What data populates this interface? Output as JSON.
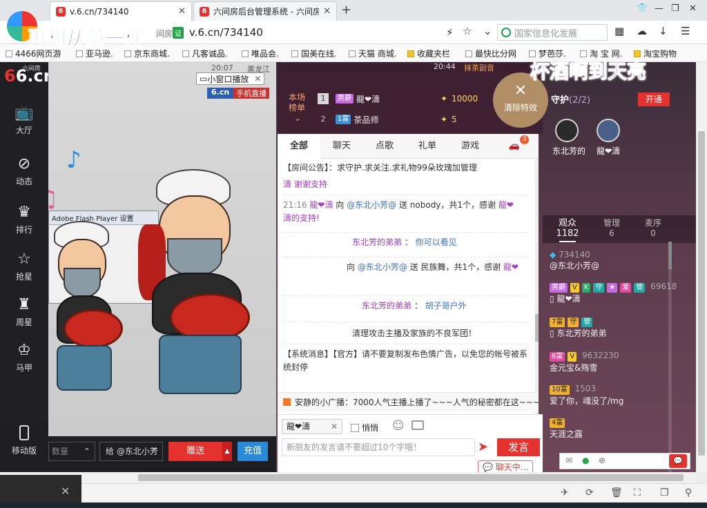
{
  "browser": {
    "tabs": [
      {
        "title": "v.6.cn/734140",
        "active": true
      },
      {
        "title": "六间房后台管理系统 - 六间房",
        "active": false
      }
    ],
    "url": "v.6.cn/734140",
    "secure_label": "证",
    "site_label": "间房",
    "search_placeholder": "国家信息化发展",
    "bookmarks": [
      "4466网页游",
      "亚马逊.",
      "京东商城.",
      "凡客诚品.",
      "唯品会.",
      "国美在线.",
      "天猫 商城.",
      "收藏夹栏",
      "最快比分网",
      "梦芭莎.",
      "淘 宝 网.",
      "淘宝购物"
    ]
  },
  "lyrics": {
    "line1": "再和从前一样",
    "line2": "杯酒啊到天亮"
  },
  "sidebar": {
    "logo": "6.cn",
    "logo_sub": "六间房",
    "items": [
      "大厅",
      "动态",
      "排行",
      "抢星",
      "周星",
      "马甲"
    ],
    "mobile": "移动版"
  },
  "player": {
    "overlay_time": "20:07",
    "overlay_name": "黑龙江",
    "mini_window": "小窗口播放",
    "badge_site": "6.cn",
    "badge_mobile": "手机直播",
    "flash_dialog_title": "Adobe Flash Player 设置"
  },
  "gift": {
    "qty_placeholder": "数量",
    "to_label": "给",
    "to_user": "@东北小芳",
    "give": "赠送",
    "recharge": "充值"
  },
  "chat_header": {
    "time": "20:44",
    "sub_text": "抹茶副音",
    "rank_title": "本场榜单",
    "rank": [
      {
        "no": "1",
        "badge": "男爵",
        "name": "龍❤濤",
        "coins": "10000"
      },
      {
        "no": "2",
        "badge": "1富",
        "name": "茶品师",
        "coins": "5"
      }
    ],
    "clear_effects": "清除特效"
  },
  "chat_tabs": [
    {
      "label": "全部",
      "active": true
    },
    {
      "label": "聊天"
    },
    {
      "label": "点歌"
    },
    {
      "label": "礼单"
    },
    {
      "label": "游戏"
    },
    {
      "label": "",
      "badge": "3"
    }
  ],
  "chat": {
    "announce_prefix": "【房间公告】：",
    "announce": "求守护.求关注.求礼物99朵玫瑰加管理",
    "partial": "濤 谢谢支持",
    "msg1_time": "21:16",
    "msg1_from": "龍❤濤",
    "msg1_to": "@东北小芳@",
    "msg1_text": "送 nobody，共1个，感谢",
    "msg1_thanks": "龍❤",
    "msg1_tail": "濤的支持!",
    "msg2_from": "东北芳的弟弟",
    "msg2_text": "你可以看见",
    "msg3_to": "@东北小芳@",
    "msg3_text": "送 民族舞，共1个，感谢",
    "msg3_thanks": "龍❤",
    "msg4_from": "东北芳的弟弟",
    "msg4_text": "胡子哥户外",
    "sys1": "清理攻击主播及家族的不良军团！",
    "sys2_prefix": "【系统消息】【官方】",
    "sys2": "请不要复制发布色情广告，以免您的帐号被系统封停",
    "broadcast": "安静的小广播：7000人气主播上播了~~~人气的秘密都在这~~~"
  },
  "input": {
    "target": "龍❤濤",
    "whisper": "悄悄",
    "placeholder": "新朋友的发言请不要超过10个字哦！",
    "send": "发言",
    "chatting": "聊天中..."
  },
  "right": {
    "guard_label": "守护",
    "guard_count": "(2/2)",
    "open": "开通",
    "guards": [
      "东北芳的",
      "龍❤濤"
    ],
    "tabs": [
      {
        "label": "观众",
        "count": "1182",
        "active": true
      },
      {
        "label": "管理",
        "count": "6"
      },
      {
        "label": "麦序",
        "count": "0"
      }
    ],
    "audience": [
      {
        "id": "734140",
        "name": "@东北小芳@"
      },
      {
        "id": "69618",
        "name": "龍❤濤"
      },
      {
        "id": "",
        "name": "东北芳的弟弟"
      },
      {
        "id": "9632230",
        "name": "金元宝&殇雪"
      },
      {
        "id": "1503",
        "name": "爱了你，魂没了/mg"
      },
      {
        "id": "",
        "name": "天涯之露"
      }
    ],
    "badges": {
      "row2": [
        "男爵",
        "V",
        "K",
        "守",
        "★",
        "爱",
        "管"
      ],
      "row3": [
        "7富",
        "守",
        "管"
      ],
      "row4": [
        "8富",
        "V"
      ],
      "row5": [
        "10富"
      ],
      "row6": [
        "4富"
      ]
    }
  },
  "colors": {
    "brand_red": "#e4322f",
    "accent_blue": "#2b8ad8"
  }
}
